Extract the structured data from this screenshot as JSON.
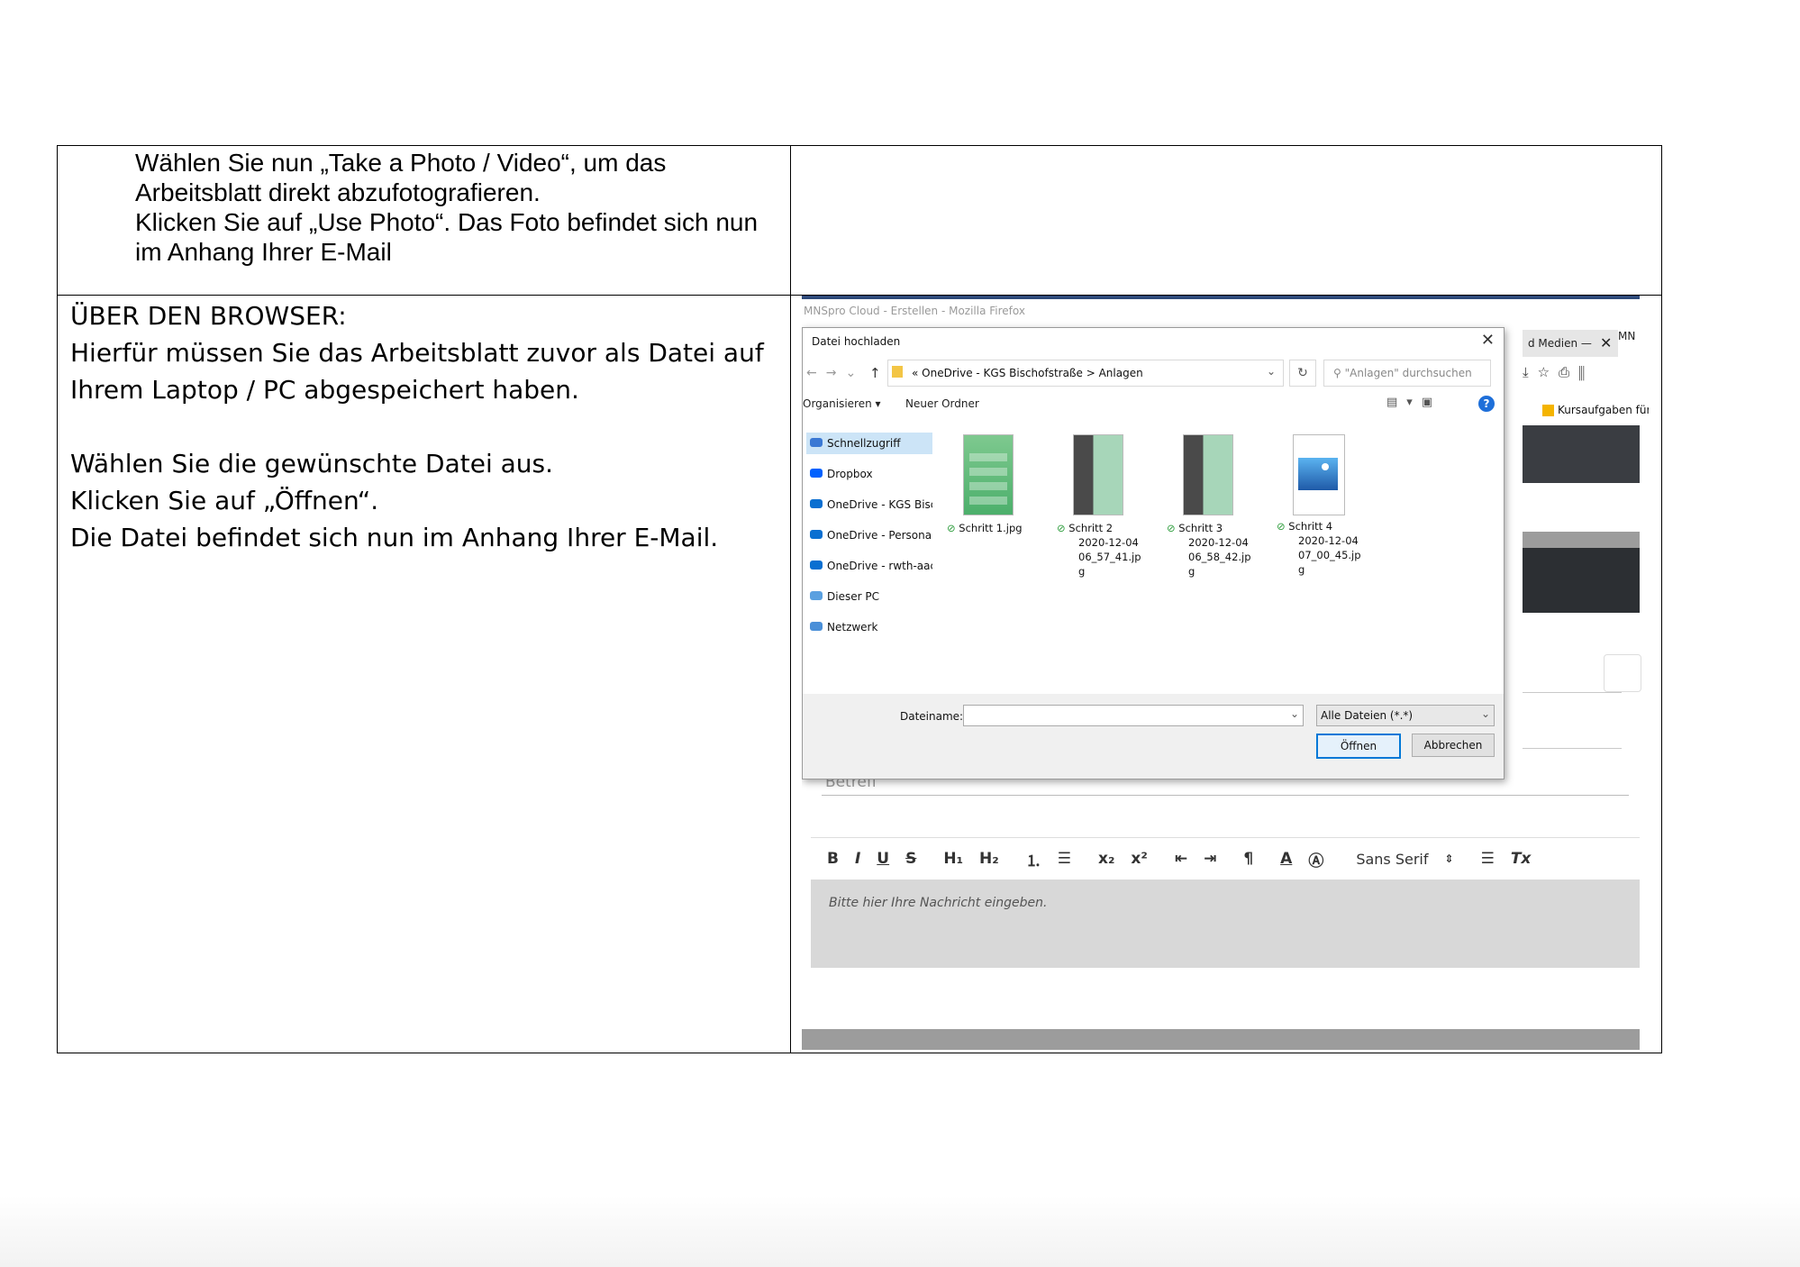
{
  "row1": {
    "lines": [
      "Wählen Sie nun „Take a Photo / Video“, um das",
      "Arbeitsblatt direkt abzufotografieren.",
      "Klicken Sie auf „Use Photo“. Das Foto befindet sich nun",
      "im Anhang Ihrer E-Mail"
    ]
  },
  "row2": {
    "heading": "ÜBER DEN BROWSER:",
    "para1_line1": "Hierfür müssen Sie das Arbeitsblatt zuvor als Datei auf",
    "para1_line2": "Ihrem Laptop / PC abgespeichert haben.",
    "para2_line1": "Wählen Sie die gewünschte Datei aus.",
    "para2_line2": "Klicken Sie auf „Öffnen“.",
    "para2_line3": "Die Datei befindet sich nun im Anhang Ihrer E-Mail."
  },
  "screenshot": {
    "window_title": "MNSpro Cloud - Erstellen - Mozilla Firefox",
    "tab_label": "d Medien —",
    "tab_label_2": "MN",
    "bookmark_label": "Kursaufgaben für \"The...",
    "betreff_placeholder": "Betreff",
    "editor": {
      "font_label": "Sans Serif",
      "body_placeholder": "Bitte hier Ihre Nachricht eingeben."
    },
    "dialog": {
      "title": "Datei hochladen",
      "address": "« OneDrive - KGS Bischofstraße  >  Anlagen",
      "search_placeholder": "\"Anlagen\" durchsuchen",
      "organize_label": "Organisieren ▾",
      "new_folder_label": "Neuer Ordner",
      "sidebar": [
        {
          "label": "Schnellzugriff",
          "icon": "star-icon",
          "color": "#3a78d4"
        },
        {
          "label": "Dropbox",
          "icon": "dropbox-icon",
          "color": "#0061fe"
        },
        {
          "label": "OneDrive - KGS Bisch",
          "icon": "cloud-icon",
          "color": "#0a6fd1"
        },
        {
          "label": "OneDrive - Personal",
          "icon": "cloud-icon",
          "color": "#0a6fd1"
        },
        {
          "label": "OneDrive - rwth-aach",
          "icon": "cloud-icon",
          "color": "#0a6fd1"
        },
        {
          "label": "Dieser PC",
          "icon": "pc-icon",
          "color": "#5aa0e0"
        },
        {
          "label": "Netzwerk",
          "icon": "network-icon",
          "color": "#4a8fd8"
        }
      ],
      "files": [
        {
          "name_l1": "Schritt 1.jpg",
          "name_l2": "",
          "name_l3": "",
          "name_l4": ""
        },
        {
          "name_l1": "Schritt 2",
          "name_l2": "2020-12-04",
          "name_l3": "06_57_41.jp",
          "name_l4": "g"
        },
        {
          "name_l1": "Schritt 3",
          "name_l2": "2020-12-04",
          "name_l3": "06_58_42.jp",
          "name_l4": "g"
        },
        {
          "name_l1": "Schritt 4",
          "name_l2": "2020-12-04",
          "name_l3": "07_00_45.jp",
          "name_l4": "g"
        }
      ],
      "filename_label": "Dateiname:",
      "filetype_value": "Alle Dateien (*.*)",
      "open_label": "Öffnen",
      "cancel_label": "Abbrechen"
    }
  }
}
